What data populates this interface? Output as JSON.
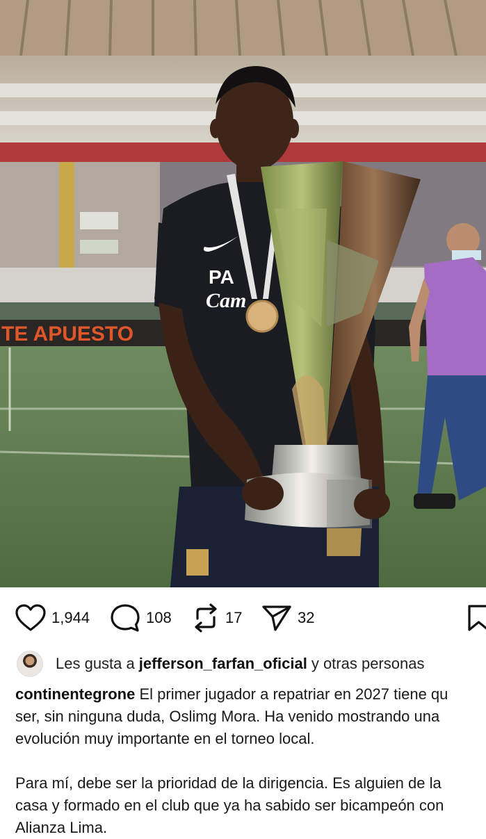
{
  "post": {
    "actions": {
      "likes": "1,944",
      "comments": "108",
      "reposts": "17",
      "shares": "32"
    },
    "liked_by": {
      "prefix": "Les gusta a",
      "user": "jefferson_farfan_oficial",
      "suffix": "y otras personas"
    },
    "caption": {
      "username": "continentegrone",
      "line1_text": "El primer jugador a repatriar en 2027 tiene qu",
      "line2": "ser, sin ninguna duda, Oslimg Mora. Ha venido mostrando una",
      "line3": "evolución muy importante en el torneo local.",
      "line4": "Para mí, debe ser la prioridad de la dirigencia. Es alguien de la",
      "line5": "casa y formado en el club que ya ha sabido ser bicampeón con",
      "line6": "Alianza Lima."
    },
    "photo": {
      "banner_text": "TE APUESTO",
      "shirt_text_1": "PA",
      "shirt_text_2": "Cam"
    }
  }
}
